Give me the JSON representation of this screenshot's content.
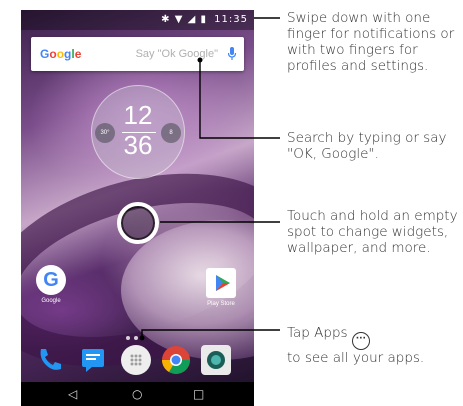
{
  "status_bar": {
    "icons_text": "✱ ▼ ◢ ▮",
    "time": "11:35"
  },
  "search": {
    "logo": [
      "G",
      "o",
      "o",
      "g",
      "l",
      "e"
    ],
    "logo_colors": [
      "#4285f4",
      "#ea4335",
      "#fbbc05",
      "#4285f4",
      "#34a853",
      "#ea4335"
    ],
    "placeholder": "Say \"Ok Google\""
  },
  "clock_widget": {
    "hour": "12",
    "minute": "36",
    "temperature": "30°",
    "battery": "8"
  },
  "home_apps": [
    {
      "label": "Google",
      "glyph": "G"
    },
    {
      "label": "Play Store",
      "glyph": "▶"
    }
  ],
  "dock_icons": [
    "phone-icon",
    "messages-icon",
    "apps-icon",
    "chrome-icon",
    "camera-icon"
  ],
  "nav": {
    "back": "◁",
    "home": "○",
    "recent": "□"
  },
  "callouts": {
    "swipe": "Swipe down with one finger for notifications or with two fingers for profiles and settings.",
    "search": "Search by typing or say \"OK, Google\".",
    "touch": "Touch and hold an empty spot to change widgets, wallpaper, and more.",
    "apps_prefix": "Tap Apps",
    "apps_icon": "···",
    "apps_suffix": "to see all your apps."
  }
}
